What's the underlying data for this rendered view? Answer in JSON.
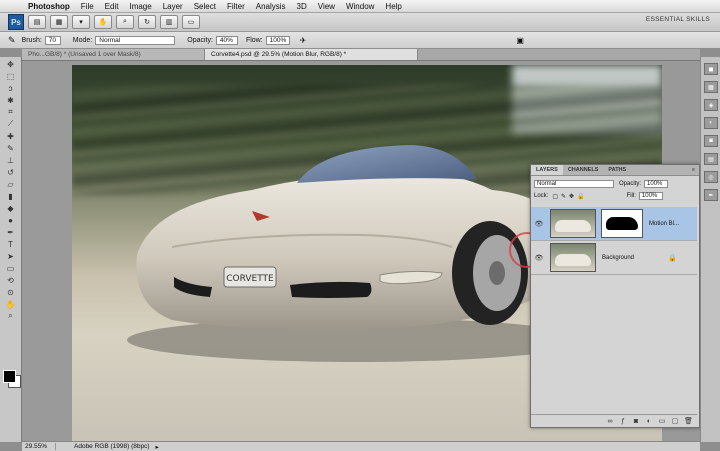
{
  "menubar": {
    "items": [
      "Photoshop",
      "File",
      "Edit",
      "Image",
      "Layer",
      "Select",
      "Filter",
      "Analysis",
      "3D",
      "View",
      "Window",
      "Help"
    ],
    "workspace": "ESSENTIAL SKILLS"
  },
  "appbar": {
    "logo": "Ps"
  },
  "options": {
    "brush_label": "Brush:",
    "brush_size": "70",
    "mode_label": "Mode:",
    "mode_value": "Normal",
    "opacity_label": "Opacity:",
    "opacity_value": "40%",
    "flow_label": "Flow:",
    "flow_value": "100%"
  },
  "tabs": [
    {
      "label": "Pho...GB/8) * (Unsaved 1 over Mask/8)"
    },
    {
      "label": "Corvette4.psd @ 29.5% (Motion Blur, RGB/8) *"
    }
  ],
  "layers_panel": {
    "tabs": [
      "LAYERS",
      "CHANNELS",
      "PATHS"
    ],
    "blend_mode": "Normal",
    "opacity_label": "Opacity:",
    "opacity_value": "100%",
    "lock_label": "Lock:",
    "fill_label": "Fill:",
    "fill_value": "100%",
    "layers": [
      {
        "name": "Motion Bl...",
        "selected": true
      },
      {
        "name": "Background",
        "selected": false
      }
    ]
  },
  "status": {
    "zoom": "29.55%",
    "doc": "Adobe RGB (1998) (8bpc)"
  },
  "colors": {
    "accent_selected": "#a9c5e6",
    "cursor_ring": "#dc3c46"
  }
}
